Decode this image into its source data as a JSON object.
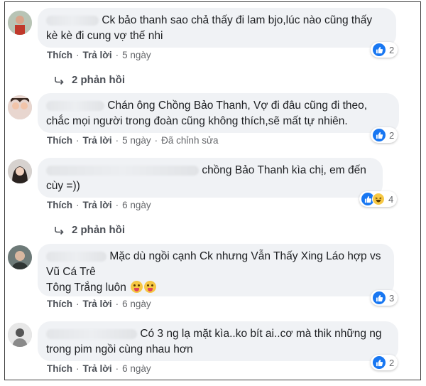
{
  "comments": [
    {
      "text_lines": [
        "Ck bảo thanh sao chả thấy đi lam bjo,lúc nào cũng thấy",
        "kè kè đi cung vợ thế nhi"
      ],
      "actions": {
        "like": "Thích",
        "reply": "Trả lời",
        "time": "5 ngày"
      },
      "reaction_count": "2",
      "replies_label": "2 phản hồi"
    },
    {
      "text_lines": [
        "Chán ông Chồng Bảo Thanh, Vợ đi đâu cũng đi theo,",
        "chắc mọi người trong đoàn cũng không thích,sẽ mất tự nhiên."
      ],
      "actions": {
        "like": "Thích",
        "reply": "Trả lời",
        "time": "5 ngày",
        "edited": "Đã chỉnh sửa"
      },
      "reaction_count": "2"
    },
    {
      "text_lines": [
        "chồng Bảo Thanh kìa chị, em đến",
        "cùy =))"
      ],
      "actions": {
        "like": "Thích",
        "reply": "Trả lời",
        "time": "6 ngày"
      },
      "reaction_count": "4",
      "replies_label": "2 phản hồi"
    },
    {
      "text_lines": [
        "Mặc dù ngồi cạnh Ck nhưng Vẫn Thấy Xing Láo hợp vs",
        "Vũ Cá Trê",
        "Tông Trắng luôn"
      ],
      "actions": {
        "like": "Thích",
        "reply": "Trả lời",
        "time": "6 ngày"
      },
      "reaction_count": "3"
    },
    {
      "text_lines": [
        "Có 3 ng lạ mặt kìa..ko bít ai..cơ mà thik những ng",
        "trong pim ngồi cùng nhau hơn"
      ],
      "actions": {
        "like": "Thích",
        "reply": "Trả lời",
        "time": "6 ngày"
      },
      "reaction_count": "2"
    }
  ],
  "icons": {
    "like": "thumbs-up-icon",
    "haha": "laughing-face-icon",
    "reply_arrow": "reply-arrow-icon",
    "emoji": "tongue-out-emoji-icon"
  },
  "colors": {
    "like_blue": "#1877f2",
    "bubble_bg": "#f0f2f5",
    "meta_gray": "#65676b"
  }
}
